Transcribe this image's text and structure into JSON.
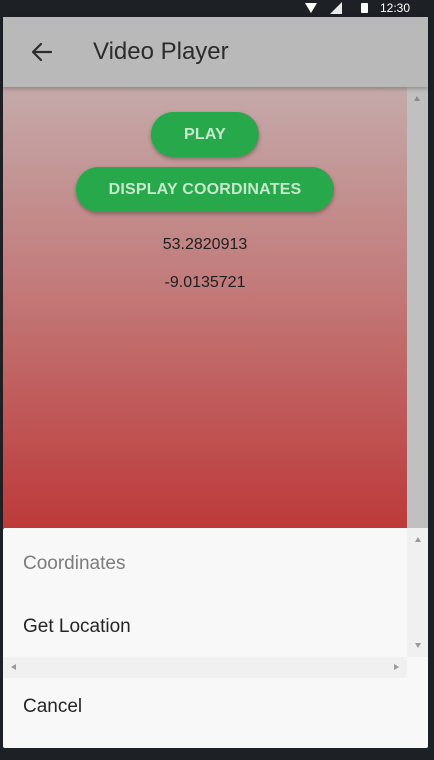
{
  "status_bar": {
    "time": "12:30",
    "icons": [
      "wifi-icon",
      "signal-icon",
      "battery-icon"
    ]
  },
  "app_bar": {
    "back_icon": "arrow-left-icon",
    "title": "Video Player",
    "background": "#b9b9b9"
  },
  "main": {
    "play_button_label": "PLAY",
    "display_coordinates_label": "DISPLAY COORDINATES",
    "latitude": "53.2820913",
    "longitude": "-9.0135721",
    "button_color": "#27a84b",
    "gradient_top": "#c4aaaa",
    "gradient_bottom": "#bd3a3a"
  },
  "sheet": {
    "header": "Coordinates",
    "items": [
      {
        "label": "Get Location"
      }
    ],
    "cancel_label": "Cancel"
  }
}
